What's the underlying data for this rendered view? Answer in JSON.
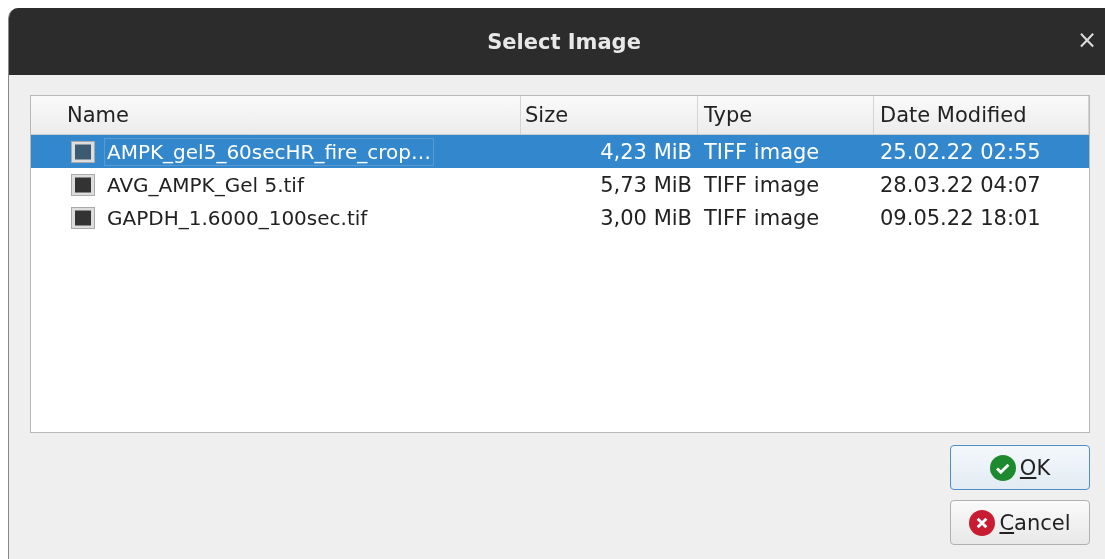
{
  "window": {
    "title": "Select Image",
    "close": "×"
  },
  "table": {
    "columns": [
      "Name",
      "Size",
      "Type",
      "Date Modified"
    ],
    "rows": [
      {
        "name": "AMPK_gel5_60secHR_fire_crop…",
        "size": "4,23 MiB",
        "type": "TIFF image",
        "date": "25.02.22 02:55",
        "selected": true
      },
      {
        "name": "AVG_AMPK_Gel 5.tif",
        "size": "5,73 MiB",
        "type": "TIFF image",
        "date": "28.03.22 04:07",
        "selected": false
      },
      {
        "name": "GAPDH_1.6000_100sec.tif",
        "size": "3,00 MiB",
        "type": "TIFF image",
        "date": "09.05.22 18:01",
        "selected": false
      }
    ]
  },
  "buttons": [
    {
      "label": "OK",
      "kind": "ok"
    },
    {
      "label": "Cancel",
      "kind": "cancel"
    }
  ]
}
